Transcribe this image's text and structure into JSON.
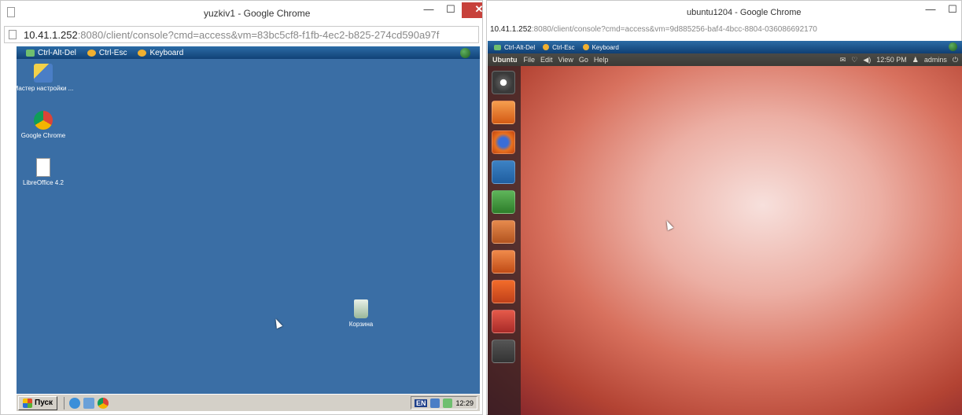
{
  "left_window": {
    "title": "yuzkiv1 - Google Chrome",
    "controls": {
      "minimize": "—",
      "maximize": "☐",
      "close": "✕"
    },
    "url_host": "10.41.1.252",
    "url_rest": ":8080/client/console?cmd=access&vm=83bc5cf8-f1fb-4ec2-b825-274cd590a97f",
    "toolbar": {
      "ctrl_alt_del": "Ctrl-Alt-Del",
      "ctrl_esc": "Ctrl-Esc",
      "keyboard": "Keyboard"
    },
    "desktop_icons": [
      {
        "label": "Мастер настройки ...",
        "icon": "wizard-icon"
      },
      {
        "label": "Google Chrome",
        "icon": "chrome-icon"
      },
      {
        "label": "LibreOffice 4.2",
        "icon": "libreoffice-icon"
      },
      {
        "label": "Корзина",
        "icon": "recycle-bin-icon"
      }
    ],
    "taskbar": {
      "start_label": "Пуск",
      "lang": "EN",
      "clock": "12:29"
    },
    "colors": {
      "desktop": "#3a6ea5",
      "toolbar": "#0f3f73"
    }
  },
  "right_window": {
    "title": "ubuntu1204 - Google Chrome",
    "controls": {
      "minimize": "—",
      "maximize": "☐"
    },
    "url_host": "10.41.1.252",
    "url_rest": ":8080/client/console?cmd=access&vm=9d885256-baf4-4bcc-8804-036086692170",
    "toolbar": {
      "ctrl_alt_del": "Ctrl-Alt-Del",
      "ctrl_esc": "Ctrl-Esc",
      "keyboard": "Keyboard"
    },
    "panel": {
      "app_name": "Ubuntu",
      "menus": [
        "File",
        "Edit",
        "View",
        "Go",
        "Help"
      ],
      "clock": "12:50 PM",
      "user": "admins"
    },
    "launcher": [
      "dash-icon",
      "files-icon",
      "firefox-icon",
      "writer-icon",
      "calc-icon",
      "impress-icon",
      "software-center-icon",
      "ubuntu-one-icon",
      "system-settings-icon",
      "workspace-switcher-icon"
    ],
    "colors": {
      "panel": "#3c3b37",
      "wallpaper_center": "#f7e0dc",
      "wallpaper_edge": "#7a1f2a"
    }
  }
}
